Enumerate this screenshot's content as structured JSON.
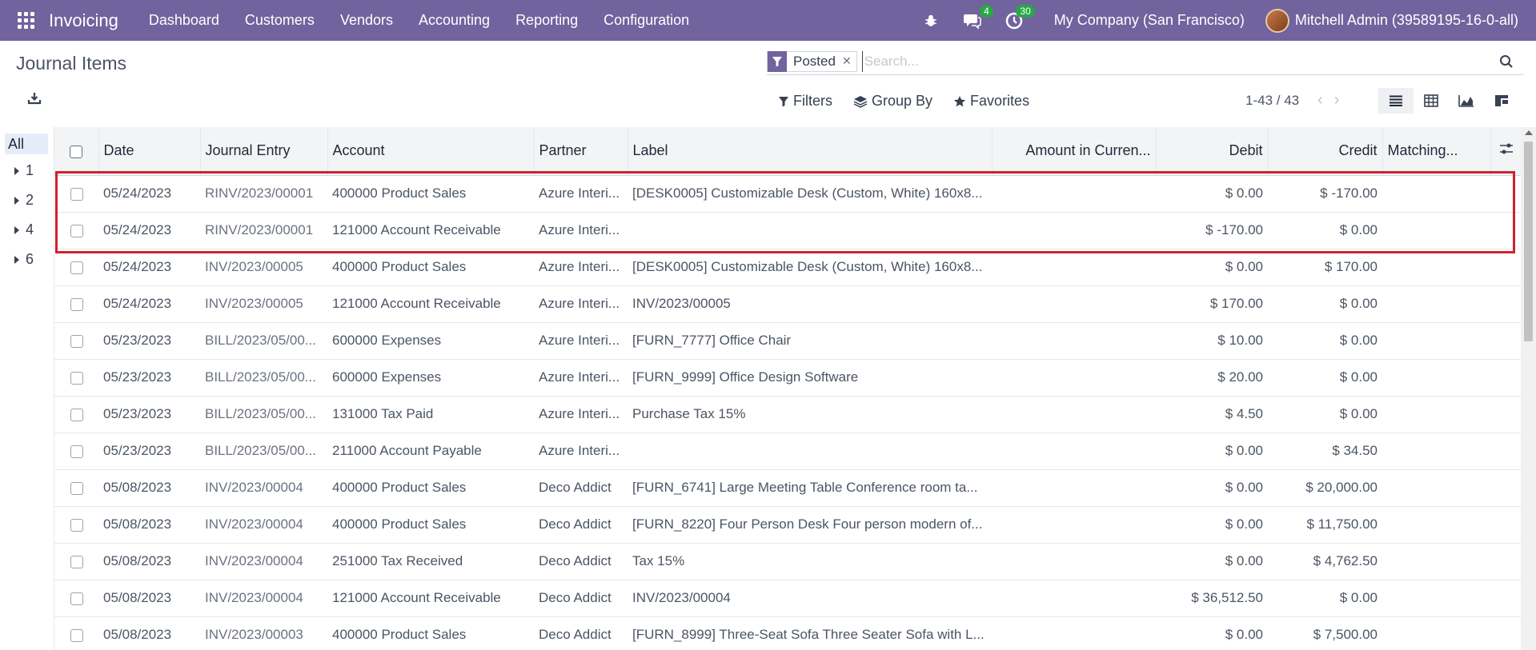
{
  "navbar": {
    "brand": "Invoicing",
    "menu": [
      "Dashboard",
      "Customers",
      "Vendors",
      "Accounting",
      "Reporting",
      "Configuration"
    ],
    "messages_badge": "4",
    "activities_badge": "30",
    "company": "My Company (San Francisco)",
    "user": "Mitchell Admin (39589195-16-0-all)"
  },
  "page": {
    "title": "Journal Items"
  },
  "search": {
    "facet": "Posted",
    "placeholder": "Search..."
  },
  "controls": {
    "filters": "Filters",
    "group_by": "Group By",
    "favorites": "Favorites",
    "pager": "1-43 / 43"
  },
  "sidepanel": {
    "items": [
      "All",
      "1",
      "2",
      "4",
      "6"
    ]
  },
  "table": {
    "columns": [
      "Date",
      "Journal Entry",
      "Account",
      "Partner",
      "Label",
      "Amount in Curren...",
      "Debit",
      "Credit",
      "Matching..."
    ],
    "rows": [
      {
        "date": "05/24/2023",
        "entry": "RINV/2023/00001",
        "account": "400000 Product Sales",
        "partner": "Azure Interi...",
        "label": "[DESK0005] Customizable Desk (Custom, White) 160x8...",
        "amount": "",
        "debit": "$ 0.00",
        "credit": "$ -170.00",
        "matching": ""
      },
      {
        "date": "05/24/2023",
        "entry": "RINV/2023/00001",
        "account": "121000 Account Receivable",
        "partner": "Azure Interi...",
        "label": "",
        "amount": "",
        "debit": "$ -170.00",
        "credit": "$ 0.00",
        "matching": ""
      },
      {
        "date": "05/24/2023",
        "entry": "INV/2023/00005",
        "account": "400000 Product Sales",
        "partner": "Azure Interi...",
        "label": "[DESK0005] Customizable Desk (Custom, White) 160x8...",
        "amount": "",
        "debit": "$ 0.00",
        "credit": "$ 170.00",
        "matching": ""
      },
      {
        "date": "05/24/2023",
        "entry": "INV/2023/00005",
        "account": "121000 Account Receivable",
        "partner": "Azure Interi...",
        "label": "INV/2023/00005",
        "amount": "",
        "debit": "$ 170.00",
        "credit": "$ 0.00",
        "matching": ""
      },
      {
        "date": "05/23/2023",
        "entry": "BILL/2023/05/00...",
        "account": "600000 Expenses",
        "partner": "Azure Interi...",
        "label": "[FURN_7777] Office Chair",
        "amount": "",
        "debit": "$ 10.00",
        "credit": "$ 0.00",
        "matching": ""
      },
      {
        "date": "05/23/2023",
        "entry": "BILL/2023/05/00...",
        "account": "600000 Expenses",
        "partner": "Azure Interi...",
        "label": "[FURN_9999] Office Design Software",
        "amount": "",
        "debit": "$ 20.00",
        "credit": "$ 0.00",
        "matching": ""
      },
      {
        "date": "05/23/2023",
        "entry": "BILL/2023/05/00...",
        "account": "131000 Tax Paid",
        "partner": "Azure Interi...",
        "label": "Purchase Tax 15%",
        "amount": "",
        "debit": "$ 4.50",
        "credit": "$ 0.00",
        "matching": ""
      },
      {
        "date": "05/23/2023",
        "entry": "BILL/2023/05/00...",
        "account": "211000 Account Payable",
        "partner": "Azure Interi...",
        "label": "",
        "amount": "",
        "debit": "$ 0.00",
        "credit": "$ 34.50",
        "matching": ""
      },
      {
        "date": "05/08/2023",
        "entry": "INV/2023/00004",
        "account": "400000 Product Sales",
        "partner": "Deco Addict",
        "label": "[FURN_6741] Large Meeting Table Conference room ta...",
        "amount": "",
        "debit": "$ 0.00",
        "credit": "$ 20,000.00",
        "matching": ""
      },
      {
        "date": "05/08/2023",
        "entry": "INV/2023/00004",
        "account": "400000 Product Sales",
        "partner": "Deco Addict",
        "label": "[FURN_8220] Four Person Desk Four person modern of...",
        "amount": "",
        "debit": "$ 0.00",
        "credit": "$ 11,750.00",
        "matching": ""
      },
      {
        "date": "05/08/2023",
        "entry": "INV/2023/00004",
        "account": "251000 Tax Received",
        "partner": "Deco Addict",
        "label": "Tax 15%",
        "amount": "",
        "debit": "$ 0.00",
        "credit": "$ 4,762.50",
        "matching": ""
      },
      {
        "date": "05/08/2023",
        "entry": "INV/2023/00004",
        "account": "121000 Account Receivable",
        "partner": "Deco Addict",
        "label": "INV/2023/00004",
        "amount": "",
        "debit": "$ 36,512.50",
        "credit": "$ 0.00",
        "matching": ""
      },
      {
        "date": "05/08/2023",
        "entry": "INV/2023/00003",
        "account": "400000 Product Sales",
        "partner": "Deco Addict",
        "label": "[FURN_8999] Three-Seat Sofa Three Seater Sofa with L...",
        "amount": "",
        "debit": "$ 0.00",
        "credit": "$ 7,500.00",
        "matching": ""
      }
    ]
  },
  "colors": {
    "navbar": "#71639e",
    "highlight": "#d0212e",
    "badge": "#28a745"
  }
}
